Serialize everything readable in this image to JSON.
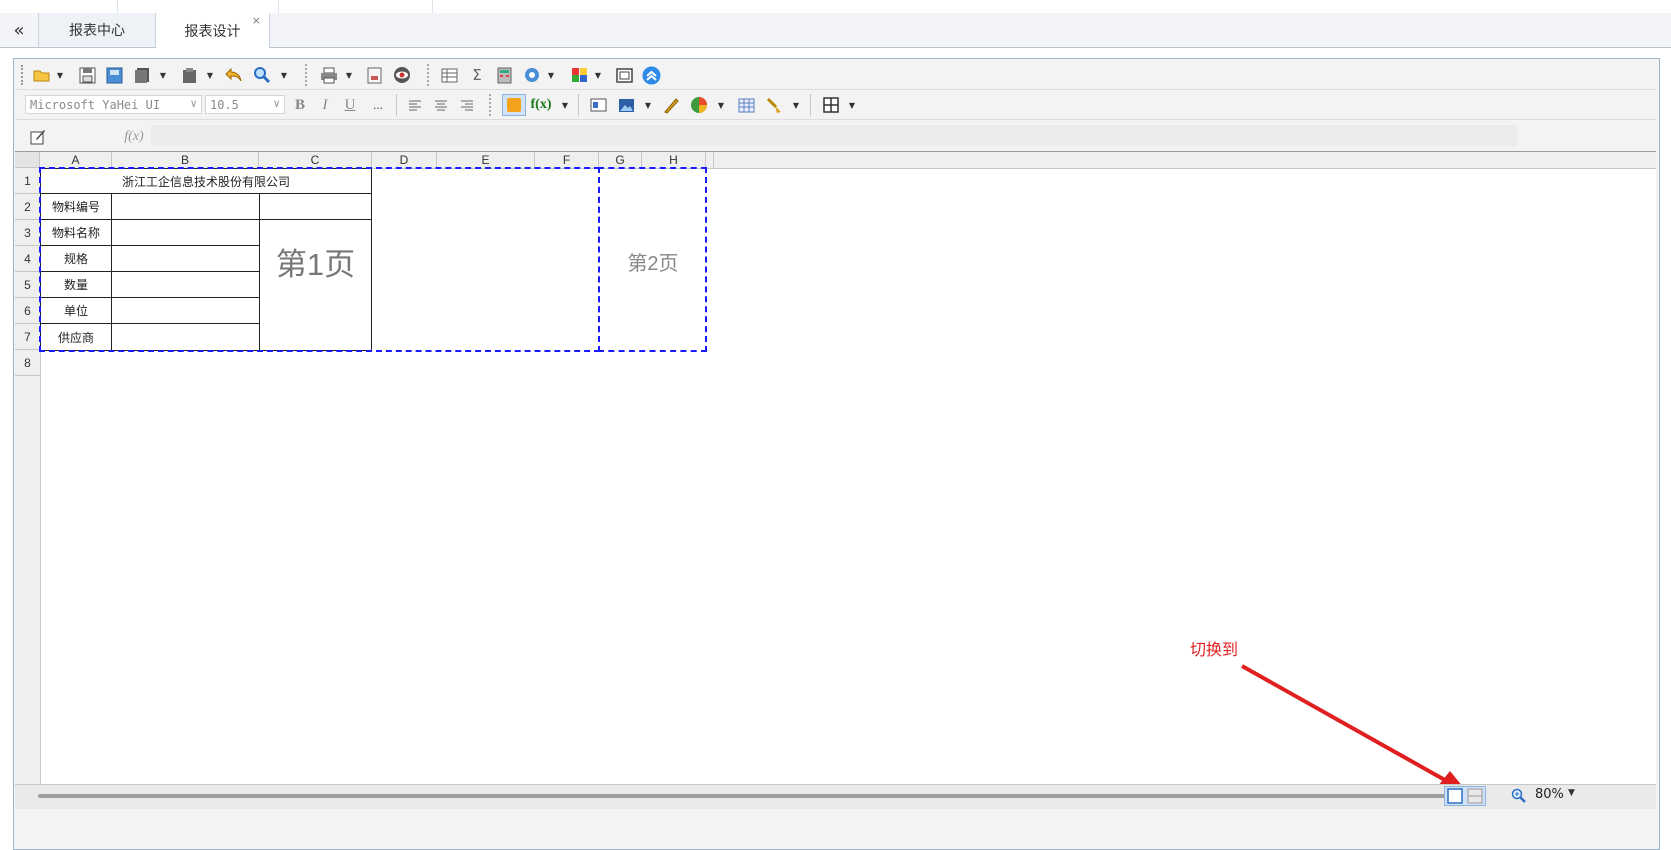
{
  "tabs": {
    "collapse_icon": "«",
    "items": [
      {
        "label": "报表中心"
      },
      {
        "label": "报表设计",
        "close": "×"
      }
    ]
  },
  "toolbar1": {
    "icons": [
      "open-folder-icon",
      "save-icon",
      "save-as-icon",
      "copy-icon",
      "paste-icon",
      "undo-icon",
      "find-icon",
      "print-icon",
      "print-preview-icon",
      "preview-icon",
      "table-icon",
      "sum-icon",
      "calculator-icon",
      "settings-icon",
      "color-palette-icon",
      "fullscreen-icon",
      "collapse-up-icon"
    ]
  },
  "toolbar2": {
    "font_name": "Microsoft YaHei UI",
    "font_size": "10.5",
    "bold_label": "B",
    "italic_label": "I",
    "underline_label": "U",
    "more_label": "...",
    "icons": [
      "align-left-icon",
      "align-center-icon",
      "align-right-icon",
      "fill-color-icon",
      "function-icon",
      "text-box-icon",
      "image-icon",
      "pen-icon",
      "pie-chart-icon",
      "grid-icon",
      "brush-icon",
      "border-icon"
    ]
  },
  "formulabar": {
    "edit_icon": "edit-icon",
    "fx_label": "f(x)",
    "value": ""
  },
  "sheet": {
    "columns": [
      "A",
      "B",
      "C",
      "D",
      "E",
      "F",
      "G",
      "H",
      ""
    ],
    "rows": [
      "1",
      "2",
      "3",
      "4",
      "5",
      "6",
      "7",
      "8"
    ],
    "title": "浙江工企信息技术股份有限公司",
    "labels": [
      "物料编号",
      "物料名称",
      "规格",
      "数量",
      "单位",
      "供应商"
    ],
    "page1_label": "第1页",
    "page2_label": "第2页"
  },
  "annotation": {
    "text": "切换到",
    "color": "#e02020"
  },
  "status": {
    "zoom": "80%"
  }
}
